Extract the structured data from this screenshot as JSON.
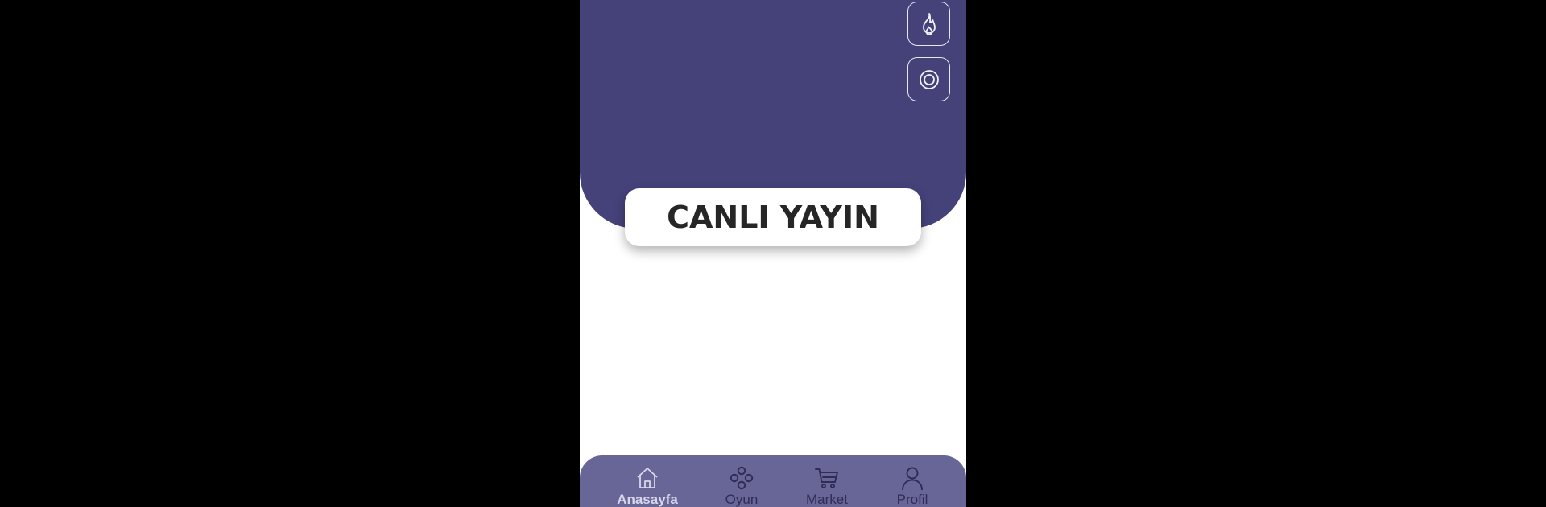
{
  "hero": {
    "buttons": [
      {
        "icon": "flame-icon"
      },
      {
        "icon": "record-icon"
      }
    ]
  },
  "title": "CANLI YAYIN",
  "bottom_nav": {
    "active": "Anasayfa",
    "items": [
      {
        "label": "Anasayfa",
        "icon": "home-icon"
      },
      {
        "label": "Oyun",
        "icon": "game-icon"
      },
      {
        "label": "Market",
        "icon": "cart-icon"
      },
      {
        "label": "Profil",
        "icon": "user-icon"
      }
    ]
  },
  "colors": {
    "hero": "#45427a",
    "nav": "#686597",
    "nav_active_text": "#d8d7ea",
    "nav_text": "#2f2c55",
    "title_text": "#262626"
  }
}
